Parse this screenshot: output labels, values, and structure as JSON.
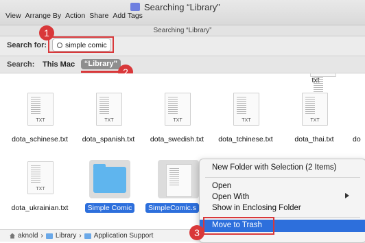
{
  "window": {
    "title": "Searching “Library”",
    "subtitle": "Searching “Library”"
  },
  "menu": [
    "View",
    "Arrange By",
    "Action",
    "Share",
    "Add Tags"
  ],
  "search": {
    "label": "Search for:",
    "value": "simple comic"
  },
  "scope": {
    "label": "Search:",
    "this_mac": "This Mac",
    "library": "“Library”"
  },
  "badges": [
    "1",
    "2",
    "3"
  ],
  "files_row1": [
    {
      "name": "dota_schinese.txt",
      "ext": "TXT"
    },
    {
      "name": "dota_spanish.txt",
      "ext": "TXT"
    },
    {
      "name": "dota_swedish.txt",
      "ext": "TXT"
    },
    {
      "name": "dota_tchinese.txt",
      "ext": "TXT"
    },
    {
      "name": "dota_thai.txt",
      "ext": "TXT"
    }
  ],
  "top_right_partial": "txt",
  "row1_edge_partial": "do",
  "files_row2": [
    {
      "name": "dota_ukrainian.txt",
      "ext": "TXT"
    },
    {
      "name": "Simple Comic"
    },
    {
      "name": "SimpleComic.s"
    }
  ],
  "path": [
    "aknold",
    "Library",
    "Application Support"
  ],
  "context_menu": {
    "new_folder": "New Folder with Selection (2 Items)",
    "open": "Open",
    "open_with": "Open With",
    "show_enclosing": "Show in Enclosing Folder",
    "move_to_trash": "Move to Trash"
  }
}
